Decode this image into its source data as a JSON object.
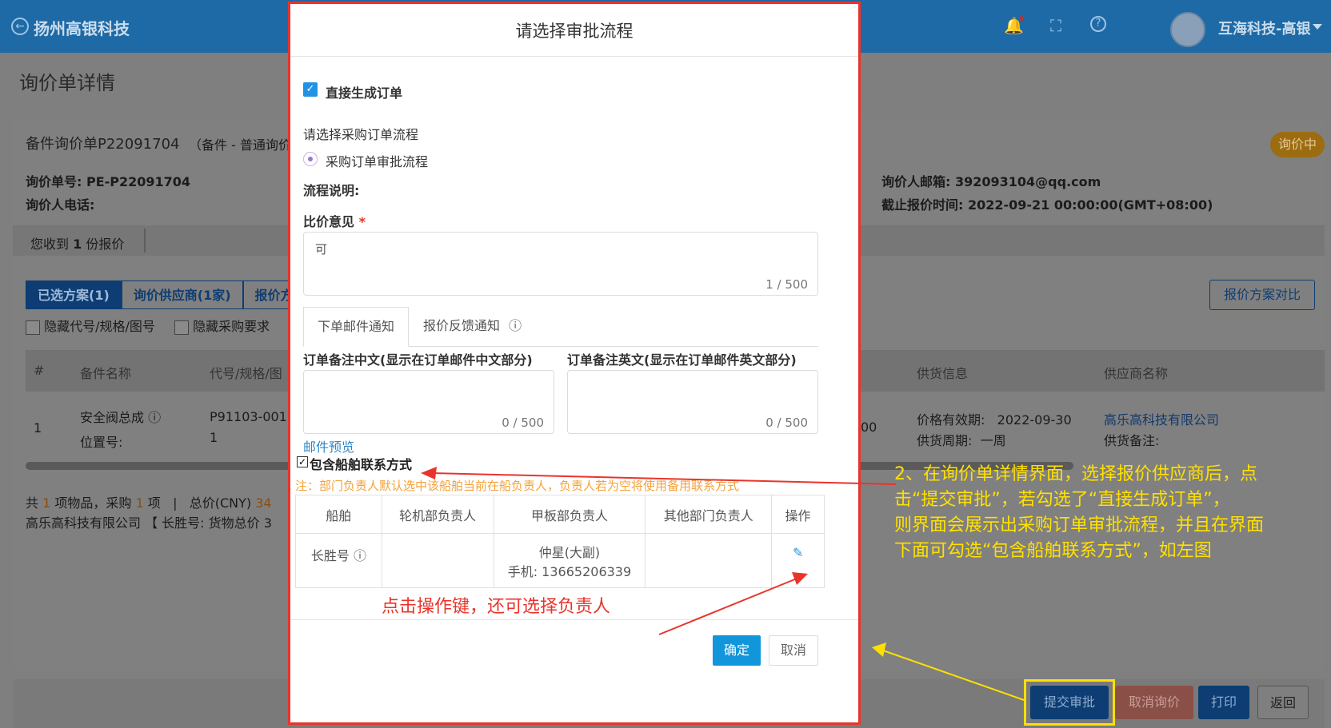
{
  "topbar": {
    "brand": "扬州高银科技",
    "user": "互海科技-高银"
  },
  "page": {
    "title": "询价单详情"
  },
  "inquiry": {
    "heading": "备件询价单P22091704",
    "type": "（备件 - 普通询价",
    "status_badge": "询价中",
    "number_label": "询价单号: PE-P22091704",
    "phone_label": "询价人电话:",
    "email_label": "询价人邮箱: 392093104@qq.com",
    "deadline_label": "截止报价时间: 2022-09-21 00:00:00(GMT+08:00)",
    "quotes_prefix": "您收到",
    "quotes_count": "1",
    "quotes_suffix": "份报价"
  },
  "tabs": [
    "已选方案(1)",
    "询价供应商(1家)",
    "报价方"
  ],
  "compare_button": "报价方案对比",
  "filters": {
    "hide_code": "隐藏代号/规格/图号",
    "hide_req": "隐藏采购要求"
  },
  "table": {
    "headers": {
      "num": "#",
      "name": "备件名称",
      "code": "代号/规格/图",
      "supply": "供货信息",
      "supplier": "供应商名称"
    },
    "row": {
      "num": "1",
      "name": "安全阀总成",
      "pos": "位置号:",
      "code": "P91103-001",
      "code2": "1",
      "amount": "00",
      "validity_label": "价格有效期:",
      "validity": "2022-09-30",
      "period_label": "供货周期:",
      "period": "一周",
      "supplier": "高乐高科技有限公司",
      "remark_label": "供货备注:"
    }
  },
  "summary": {
    "line1a": "共",
    "items": "1",
    "line1b": "项物品，采购",
    "purchase": "1",
    "line1c": "项",
    "sep": "|",
    "total_label": "总价(CNY)",
    "total": "34",
    "line2": "高乐高科技有限公司 【 长胜号: 货物总价  3"
  },
  "footer": {
    "submit": "提交审批",
    "cancel_inquiry": "取消询价",
    "print": "打印",
    "back": "返回"
  },
  "modal": {
    "title": "请选择审批流程",
    "direct_order": "直接生成订单",
    "select_flow": "请选择采购订单流程",
    "flow_option": "采购订单审批流程",
    "flow_desc": "流程说明:",
    "opinion_label": "比价意见",
    "required_mark": "*",
    "opinion_value": "可",
    "opinion_count": "1 / 500",
    "tab_order_mail": "下单邮件通知",
    "tab_feedback": "报价反馈通知",
    "remark_cn_label": "订单备注中文(显示在订单邮件中文部分)",
    "remark_en_label": "订单备注英文(显示在订单邮件英文部分)",
    "remark_cn_count": "0 / 500",
    "remark_en_count": "0 / 500",
    "mail_preview": "邮件预览",
    "include_contact": "包含船舶联系方式",
    "note": "注：部门负责人默认选中该船舶当前在船负责人，负责人若为空将使用备用联系方式",
    "grid_headers": [
      "船舶",
      "轮机部负责人",
      "甲板部负责人",
      "其他部门负责人",
      "操作"
    ],
    "grid_row": {
      "ship": "长胜号",
      "deck_name": "仲星(大副)",
      "deck_phone": "手机: 13665206339"
    },
    "confirm": "确定",
    "cancel": "取消"
  },
  "annotations": {
    "right": [
      "2、在询价单详情界面，选择报价供应商后，点",
      "击“提交审批”，若勾选了“直接生成订单”，",
      "则界面会展示出采购订单审批流程，并且在界面",
      "下面可勾选“包含船舶联系方式”，如左图"
    ],
    "bottom": "点击操作键，还可选择负责人"
  },
  "colors": {
    "primary": "#1296db",
    "annotation_red": "#e9342b",
    "annotation_yellow": "#ffe000",
    "header": "#1e6aa6"
  }
}
